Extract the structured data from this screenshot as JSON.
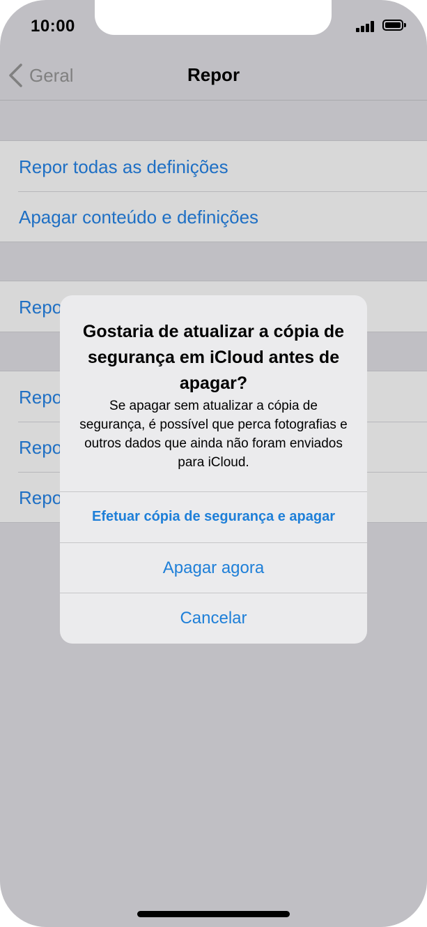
{
  "status_bar": {
    "time": "10:00",
    "icons": [
      "signal-icon",
      "battery-icon"
    ]
  },
  "nav": {
    "back_label": "Geral",
    "back_icon": "chevron-left-icon",
    "title": "Repor"
  },
  "settings": {
    "group1": [
      "Repor todas as definições",
      "Apagar conteúdo e definições"
    ],
    "group2": [
      "Repor"
    ],
    "group3": [
      "Repor",
      "Repor",
      "Repor"
    ]
  },
  "alert": {
    "title": "Gostaria de atualizar a cópia de segurança em iCloud antes de apagar?",
    "message": "Se apagar sem atualizar a cópia de segurança, é possível que perca fotografias e outros dados que ainda não foram enviados para iCloud.",
    "buttons": {
      "backup_and_erase": "Efetuar cópia de segurança e apagar",
      "erase_now": "Apagar agora",
      "cancel": "Cancelar"
    }
  },
  "colors": {
    "link": "#1e6fc4",
    "alert_button": "#1e7fd8",
    "dimmed_background": "#c0bfc4"
  }
}
